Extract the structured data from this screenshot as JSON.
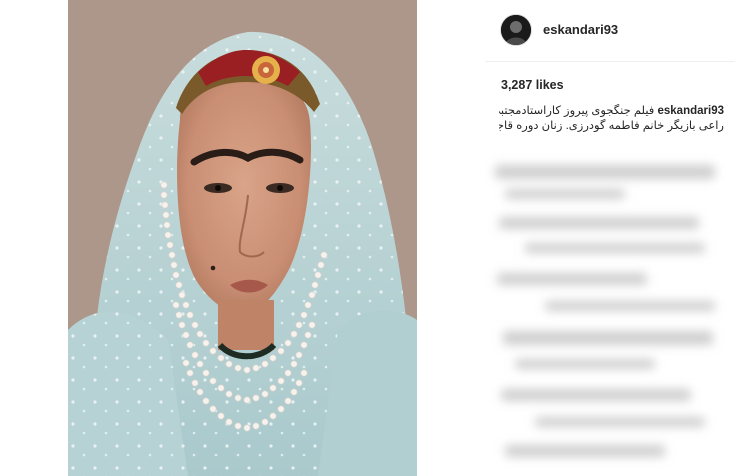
{
  "post": {
    "username": "eskandari93",
    "likes": "3,287 likes",
    "caption": {
      "user": "eskandari93",
      "line1": "فیلم جنگجوی پیروز کاراستادمجتبی",
      "line2": "راعی بازیگر خانم فاطمه گودرزی. زنان دوره قاجار"
    }
  },
  "icons": {
    "avatar": "profile-avatar-icon"
  }
}
